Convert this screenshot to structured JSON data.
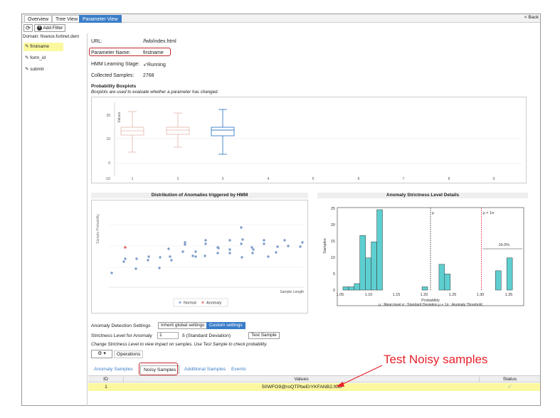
{
  "tabs": [
    {
      "label": "Overview"
    },
    {
      "label": "Tree View"
    },
    {
      "label": "Parameter View"
    }
  ],
  "back_link": "< Back",
  "toolbar": {
    "add_filter": "Add Filter"
  },
  "sidebar": {
    "domain": "Domain: finance.fortinet.dem",
    "items": [
      {
        "label": "firstname"
      },
      {
        "label": "form_id"
      },
      {
        "label": "submit"
      }
    ]
  },
  "info": {
    "url_label": "URL:",
    "url_value": "/fwb/index.html",
    "param_label": "Parameter Name:",
    "param_value": "firstname",
    "hmm_label": "HMM Learning Stage:",
    "hmm_value": "Running",
    "samples_label": "Collected Samples:",
    "samples_value": "2768"
  },
  "boxplots": {
    "title": "Probability Boxplots",
    "subtitle": "Boxplots are used to evaluate whether a parameter has changed.",
    "ylabel": "Values",
    "yticks": [
      "20",
      "10",
      "0",
      "-10"
    ],
    "xticks": [
      "1",
      "2",
      "3",
      "4",
      "5",
      "6",
      "7",
      "8",
      "9"
    ],
    "colors": {
      "pale": "#e3b5ad",
      "active": "#3a7dc8"
    }
  },
  "distribution": {
    "title": "Distribution of Anomalies triggered by HMM",
    "ylabel": "Sample Probability",
    "xlabel": "Sample Length",
    "legend": [
      "Normal",
      "Anomaly"
    ]
  },
  "strictness": {
    "title": "Anomaly Strictness Level Details",
    "yticks": [
      "25",
      "20",
      "15",
      "10",
      "5",
      "0"
    ],
    "xticks": [
      "1.05",
      "1.10",
      "1.15",
      "1.20",
      "1.25",
      "1.30",
      "1.35"
    ],
    "ylabel": "Samples",
    "xlabel": "Probability",
    "mu_label": "μ",
    "threshold_label": "μ + 1σ",
    "pct_label": "16.0%",
    "legend_text": "μ : Mean  level    σ : Standard Deviation    μ + 1σ : Anomaly Threshold"
  },
  "chart_data": {
    "type": "bar",
    "title": "Anomaly Strictness Level Details",
    "xlabel": "Probability",
    "ylabel": "Samples",
    "x": [
      1.065,
      1.075,
      1.085,
      1.095,
      1.105,
      1.115,
      1.125,
      1.135,
      1.205,
      1.235,
      1.245,
      1.335,
      1.355
    ],
    "values": [
      1,
      1,
      2,
      17,
      10,
      15,
      25,
      0,
      1,
      8,
      5,
      6,
      10
    ],
    "xlim": [
      1.05,
      1.38
    ],
    "ylim": [
      0,
      26
    ],
    "mean_line": 1.215,
    "threshold_line": 1.305
  },
  "settings": {
    "label": "Anomaly Detection Settings",
    "inherit": "Inherit global settings",
    "custom": "Custom settings",
    "strictness_label": "Strictness Level for Anomaly",
    "strictness_value": "1",
    "strictness_unit": "δ (Standard Deviation)",
    "test_sample": "Test Sample",
    "hint": "Change Strictness Level to view impact on samples. Use Test Sample to check probability."
  },
  "operations": "Operations",
  "subtabs": [
    {
      "label": "Anomaly Samples"
    },
    {
      "label": "Noisy Samples"
    },
    {
      "label": "Additional Samples"
    },
    {
      "label": "Events"
    }
  ],
  "grid": {
    "headers": {
      "id": "ID",
      "values": "Values",
      "status": "Status"
    },
    "rows": [
      {
        "id": "1",
        "value": "50WFO9@roQTPbeErYKFANB2.fGd"
      }
    ]
  },
  "callout": "Test Noisy samples"
}
